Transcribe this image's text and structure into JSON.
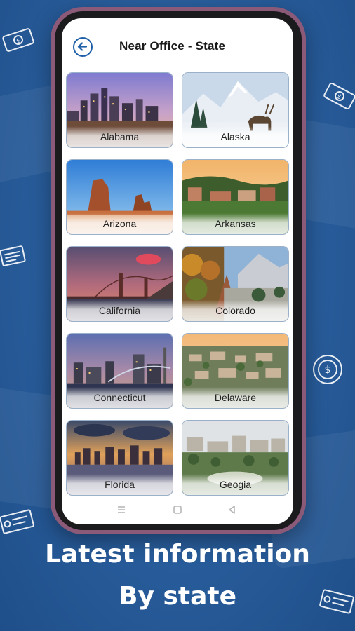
{
  "screen": {
    "title": "Near Office - State",
    "back_icon": "arrow-left-icon"
  },
  "states": [
    {
      "name": "Alabama",
      "scene": "city-dusk"
    },
    {
      "name": "Alaska",
      "scene": "mountain-snow"
    },
    {
      "name": "Arizona",
      "scene": "desert-butte"
    },
    {
      "name": "Arkansas",
      "scene": "town-hills"
    },
    {
      "name": "California",
      "scene": "bridge-sunset"
    },
    {
      "name": "Colorado",
      "scene": "autumn-canyon"
    },
    {
      "name": "Connecticut",
      "scene": "city-night"
    },
    {
      "name": "Delaware",
      "scene": "town-aerial"
    },
    {
      "name": "Florida",
      "scene": "skyline-sunset"
    },
    {
      "name": "Geogia",
      "scene": "city-park"
    }
  ],
  "system_nav": [
    "menu-icon",
    "home-icon",
    "back-icon"
  ],
  "promo": {
    "line1": "Latest information",
    "line2": "By state"
  },
  "colors": {
    "background": "#2a5f9e",
    "phone_frame": "#8a5a78",
    "accent": "#1f5fa8"
  }
}
